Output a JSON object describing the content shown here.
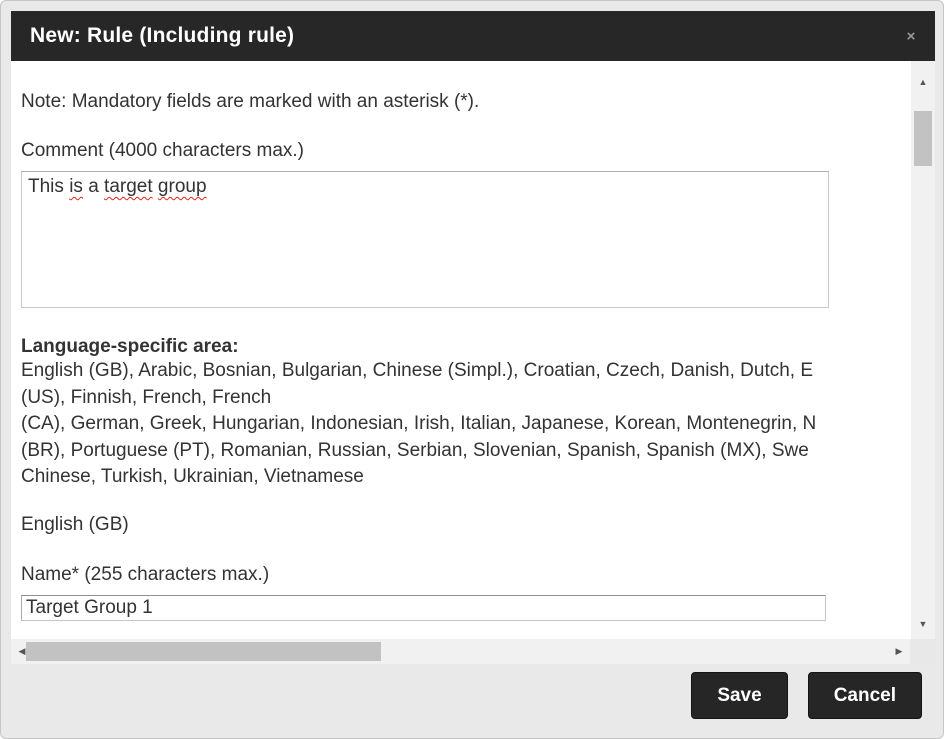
{
  "dialog": {
    "title": "New: Rule (Including rule)"
  },
  "icons": {
    "close": "×",
    "arrow_up": "▲",
    "arrow_down": "▼",
    "arrow_left": "◀",
    "arrow_right": "▶"
  },
  "body": {
    "note": "Note: Mandatory fields are marked with an asterisk (*).",
    "comment": {
      "label": "Comment (4000 characters max.)",
      "value": "This is a target group",
      "segments": [
        "This ",
        "is",
        " a ",
        "target",
        " ",
        "group"
      ]
    },
    "language_area": {
      "heading": "Language-specific area:",
      "lines": [
        "English (GB), Arabic, Bosnian, Bulgarian, Chinese (Simpl.), Croatian, Czech, Danish, Dutch, E",
        "(US), Finnish, French, French",
        "(CA), German, Greek, Hungarian, Indonesian, Irish, Italian, Japanese, Korean, Montenegrin, N",
        "(BR), Portuguese (PT), Romanian, Russian, Serbian, Slovenian, Spanish, Spanish (MX), Swe",
        "Chinese, Turkish, Ukrainian, Vietnamese"
      ]
    },
    "selected_language": "English (GB)",
    "name": {
      "label": "Name* (255 characters max.)",
      "value": "Target Group 1"
    }
  },
  "footer": {
    "save_label": "Save",
    "cancel_label": "Cancel"
  },
  "colors": {
    "header_bg": "#272727",
    "button_bg": "#262626",
    "frame_bg": "#e9e9e9",
    "text": "#333333",
    "scroll_thumb": "#c2c2c2",
    "scroll_track": "#f1f1f1",
    "spellcheck_red": "#e0261d"
  }
}
